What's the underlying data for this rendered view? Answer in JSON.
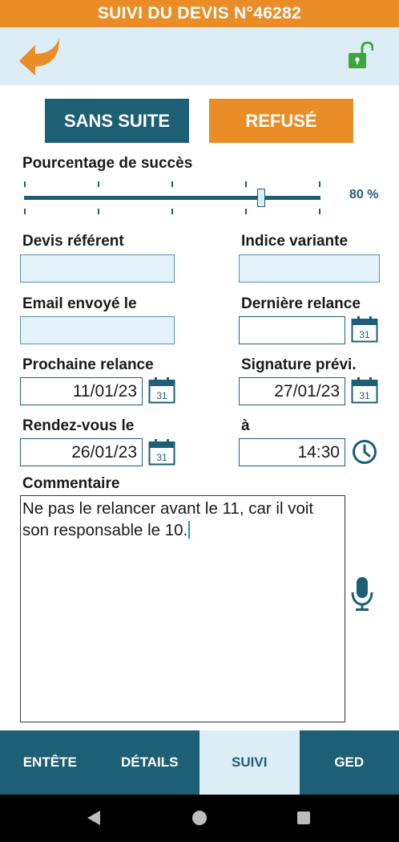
{
  "title": "SUIVI DU DEVIS N°46282",
  "toolbar": {
    "back_icon": "back-arrow-icon",
    "lock_icon": "unlocked-padlock-icon"
  },
  "actions": {
    "sans_suite": "SANS SUITE",
    "refuse": "REFUSÉ"
  },
  "success": {
    "label": "Pourcentage de succès",
    "value_text": "80 %",
    "value": 80,
    "min": 0,
    "max": 100
  },
  "fields": {
    "devis_referent": {
      "label": "Devis référent",
      "value": ""
    },
    "indice_variante": {
      "label": "Indice variante",
      "value": ""
    },
    "email_envoye": {
      "label": "Email envoyé le",
      "value": ""
    },
    "derniere_relance": {
      "label": "Dernière relance",
      "value": ""
    },
    "prochaine_relance": {
      "label": "Prochaine relance",
      "value": "11/01/23"
    },
    "signature_previ": {
      "label": "Signature prévi.",
      "value": "27/01/23"
    },
    "rendez_vous": {
      "label": "Rendez-vous le",
      "value": "26/01/23"
    },
    "rendez_vous_heure": {
      "label": "à",
      "value": "14:30"
    }
  },
  "calendar_day": "31",
  "comment": {
    "label": "Commentaire",
    "value": "Ne pas le relancer avant le 11, car il voit son responsable le 10."
  },
  "tabs": [
    {
      "label": "ENTÊTE",
      "active": false
    },
    {
      "label": "DÉTAILS",
      "active": false
    },
    {
      "label": "SUIVI",
      "active": true
    },
    {
      "label": "GED",
      "active": false
    }
  ],
  "colors": {
    "accent_orange": "#ea8d27",
    "primary_teal": "#1d5f75",
    "light_blue": "#dcedf5",
    "lock_green": "#3aa83a"
  }
}
